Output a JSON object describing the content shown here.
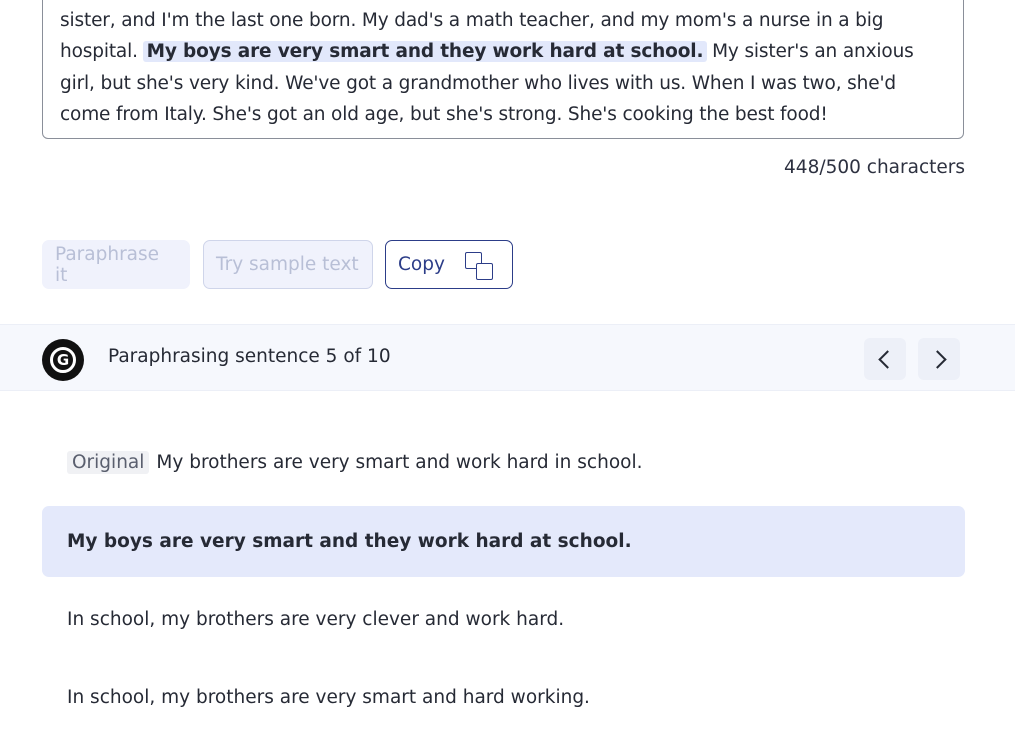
{
  "editor": {
    "text_before": "sister, and I'm the last one born.  My dad's a math teacher, and my mom's a nurse in a big hospital. ",
    "highlight": "My boys are very smart and they work hard at school.",
    "text_after": " My sister's an anxious girl, but she's very kind.  We've got a grandmother who lives with us.  When I was two, she'd come from Italy.  She's got an old age, but she's strong.  She's cooking the best food!"
  },
  "char_count": "448/500 characters",
  "buttons": {
    "paraphrase": "Paraphrase it",
    "sample": "Try sample text",
    "copy": "Copy"
  },
  "para_bar": {
    "label": "Paraphrasing sentence 5 of 10"
  },
  "original": {
    "tag": "Original",
    "text": "My brothers are very smart and work hard in school."
  },
  "options": [
    {
      "text": "My boys are very smart and they work hard at school.",
      "selected": true
    },
    {
      "text": "In school, my brothers are very clever and work hard.",
      "selected": false
    },
    {
      "text": "In school, my brothers are very smart and hard working.",
      "selected": false
    }
  ],
  "icons": {
    "copy": "copy-icon",
    "logo": "grammarly-logo-icon",
    "prev": "chevron-left-icon",
    "next": "chevron-right-icon"
  }
}
